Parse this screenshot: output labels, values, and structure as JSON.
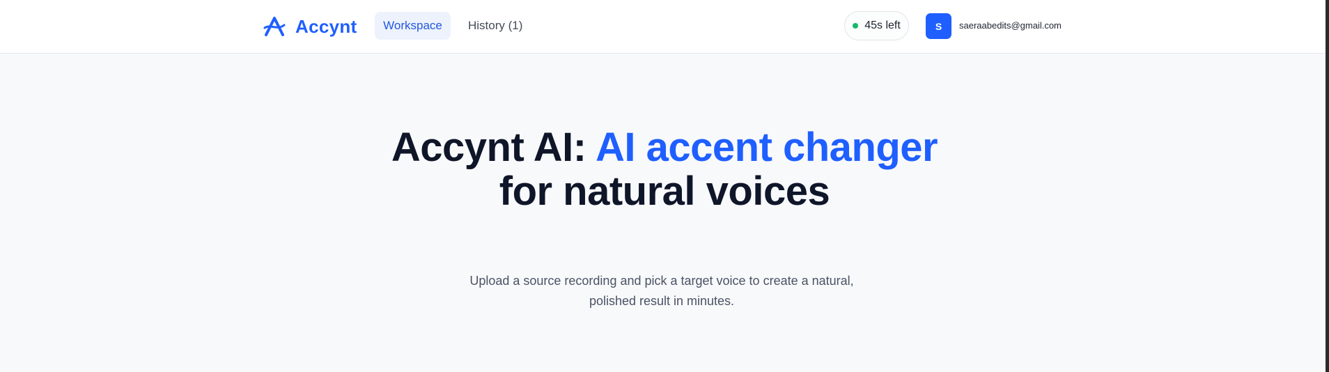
{
  "header": {
    "brand": "Accynt",
    "tabs": [
      {
        "label": "Workspace",
        "active": true
      },
      {
        "label": "History (1)",
        "active": false
      }
    ],
    "timer": "45s left",
    "avatar_initial": "S",
    "email": "saeraabedits@gmail.com"
  },
  "hero": {
    "title_part1": "Accynt AI: ",
    "title_accent": "AI accent changer",
    "title_part2": " for natural voices",
    "subtitle": "Upload a source recording and pick a target voice to create a natural, polished result in minutes."
  },
  "colors": {
    "accent": "#1f5fff",
    "title": "#0f1629",
    "status_dot": "#16b86a",
    "background": "#f8f9fb"
  },
  "icons": {
    "logo": "brand-logo-icon",
    "status": "status-dot-icon"
  }
}
